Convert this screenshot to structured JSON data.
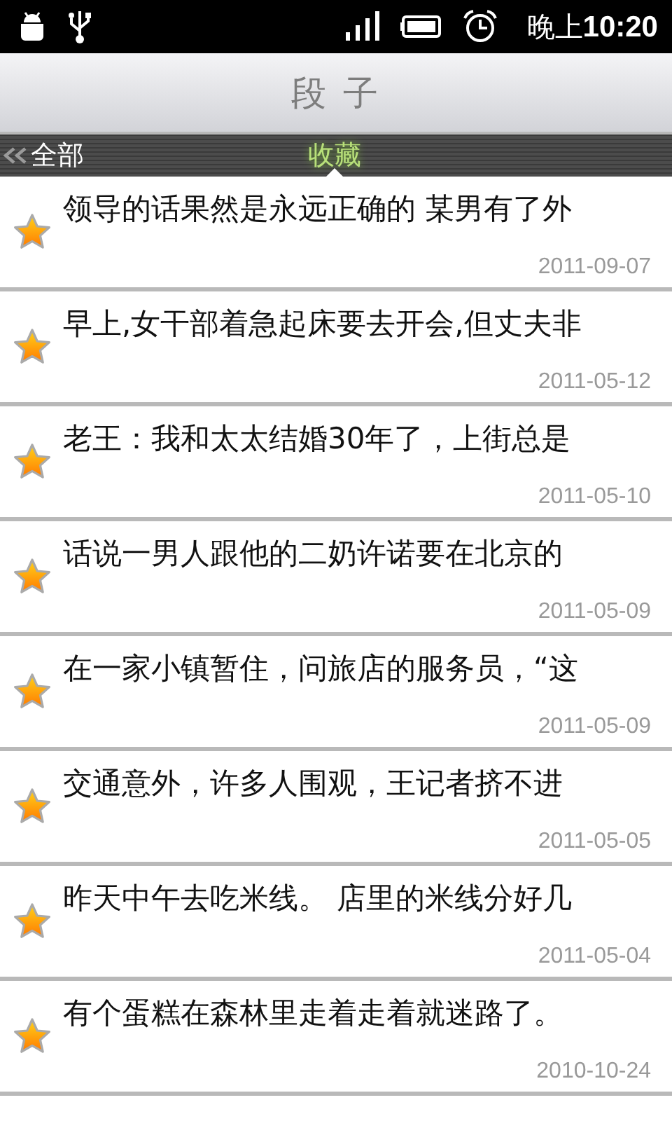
{
  "status_bar": {
    "time_prefix": "晚上",
    "time": "10:20"
  },
  "title_bar": {
    "title": "段 子"
  },
  "tabs": [
    {
      "label": "全部",
      "selected": false
    },
    {
      "label": "收藏",
      "selected": true
    }
  ],
  "items": [
    {
      "text": "领导的话果然是永远正确的 某男有了外",
      "date": "2011-09-07"
    },
    {
      "text": "早上,女干部着急起床要去开会,但丈夫非",
      "date": "2011-05-12"
    },
    {
      "text": "老王：我和太太结婚30年了，上街总是",
      "date": "2011-05-10"
    },
    {
      "text": "话说一男人跟他的二奶许诺要在北京的",
      "date": "2011-05-09"
    },
    {
      "text": "在一家小镇暂住，问旅店的服务员，“这",
      "date": "2011-05-09"
    },
    {
      "text": "交通意外，许多人围观，王记者挤不进",
      "date": "2011-05-05"
    },
    {
      "text": "昨天中午去吃米线。 店里的米线分好几",
      "date": "2011-05-04"
    },
    {
      "text": "有个蛋糕在森林里走着走着就迷路了。",
      "date": "2010-10-24"
    }
  ]
}
